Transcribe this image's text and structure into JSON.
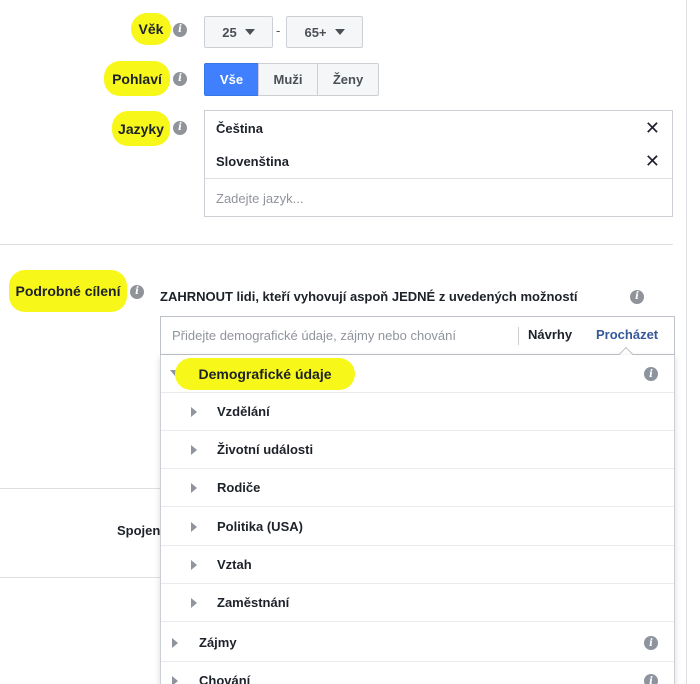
{
  "age": {
    "label": "Věk",
    "from": "25",
    "separator": "-",
    "to": "65+"
  },
  "gender": {
    "label": "Pohlaví",
    "options": [
      "Vše",
      "Muži",
      "Ženy"
    ],
    "selected": "Vše"
  },
  "languages": {
    "label": "Jazyky",
    "selected": [
      "Čeština",
      "Slovenština"
    ],
    "remove_glyph": "✕",
    "placeholder": "Zadejte jazyk..."
  },
  "detailed_targeting": {
    "label": "Podrobné cílení",
    "include_text": "ZAHRNOUT lidi, kteří vyhovují aspoň JEDNÉ z uvedených možností",
    "search_placeholder": "Přidejte demografické údaje, zájmy nebo chování",
    "tab_suggestions": "Návrhy",
    "tab_browse": "Procházet",
    "categories": [
      {
        "label": "Demografické údaje",
        "expanded": true,
        "children": [
          "Vzdělání",
          "Životní události",
          "Rodiče",
          "Politika (USA)",
          "Vztah",
          "Zaměstnání"
        ]
      },
      {
        "label": "Zájmy",
        "expanded": false
      },
      {
        "label": "Chování",
        "expanded": false
      }
    ]
  },
  "connections": {
    "label_partial": "Spojen"
  },
  "colors": {
    "highlight": "#f7f71a",
    "accent_blue": "#4080ff",
    "link_blue": "#365899",
    "border": "#ccd0d5"
  },
  "icons": {
    "info": "info-icon",
    "close": "close-icon",
    "dropdown": "caret-down-icon",
    "expand": "triangle-right-icon",
    "collapse": "triangle-down-icon"
  }
}
